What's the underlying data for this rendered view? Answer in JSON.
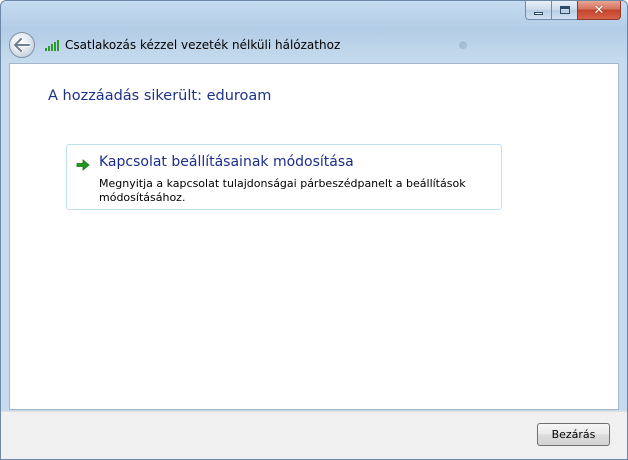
{
  "window": {
    "title_bar": {
      "buttons": {
        "minimize_icon": "minimize-icon",
        "maximize_icon": "maximize-icon",
        "close_icon": "close-icon",
        "close_glyph": "✕"
      }
    },
    "nav": {
      "back_icon": "back-arrow-icon",
      "signal_icon": "wireless-signal-icon",
      "title": "Csatlakozás kézzel vezeték nélküli hálózathoz"
    }
  },
  "content": {
    "heading": "A hozzáadás sikerült: eduroam",
    "option": {
      "icon": "green-arrow-icon",
      "title": "Kapcsolat beállításainak módosítása",
      "description": "Megnyitja a kapcsolat tulajdonságai párbeszédpanelt a beállítások módosításához."
    }
  },
  "footer": {
    "close_label": "Bezárás"
  },
  "colors": {
    "heading": "#1e3287",
    "link_title": "#1b2d8f",
    "arrow": "#1e9a1e",
    "signal": "#2e9b2e"
  }
}
